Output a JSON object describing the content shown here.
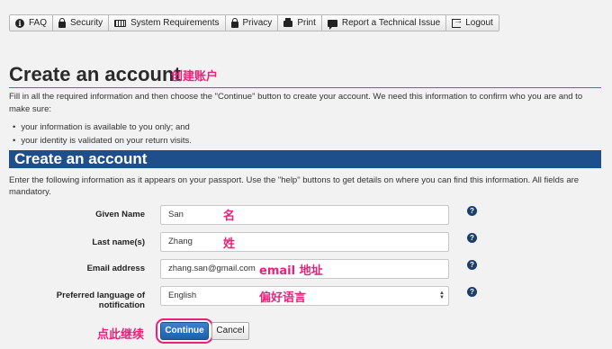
{
  "toolbar": {
    "items": [
      {
        "label": "FAQ",
        "icon": "info-icon"
      },
      {
        "label": "Security",
        "icon": "lock-icon"
      },
      {
        "label": "System Requirements",
        "icon": "keyboard-icon"
      },
      {
        "label": "Privacy",
        "icon": "lock-icon"
      },
      {
        "label": "Print",
        "icon": "printer-icon"
      },
      {
        "label": "Report a Technical Issue",
        "icon": "chat-icon"
      },
      {
        "label": "Logout",
        "icon": "logout-icon"
      }
    ]
  },
  "page": {
    "title": "Create an account",
    "title_annotation": "创建账户",
    "intro": "Fill in all the required information and then choose the \"Continue\" button to create your account. We need this information to confirm who you are and to make sure:",
    "bullets": [
      "your information is available to you only; and",
      "your identity is validated on your return visits."
    ]
  },
  "section": {
    "title": "Create an account",
    "description": "Enter the following information as it appears on your passport. Use the \"help\" buttons to get details on where you can find this information. All fields are mandatory."
  },
  "form": {
    "given_name": {
      "label": "Given Name",
      "value": "San",
      "annotation": "名"
    },
    "last_name": {
      "label": "Last name(s)",
      "value": "Zhang",
      "annotation": "姓"
    },
    "email": {
      "label": "Email address",
      "value": "zhang.san@gmail.com",
      "annotation": "email 地址"
    },
    "language": {
      "label": "Preferred language of notification",
      "value": "English",
      "annotation": "偏好语言"
    },
    "help_glyph": "?"
  },
  "actions": {
    "continue_label": "Continue",
    "cancel_label": "Cancel",
    "continue_annotation": "点此继续"
  },
  "colors": {
    "section_bar": "#1f4f8a",
    "annotation": "#e8227a",
    "continue_button": "#2a6fbb"
  }
}
